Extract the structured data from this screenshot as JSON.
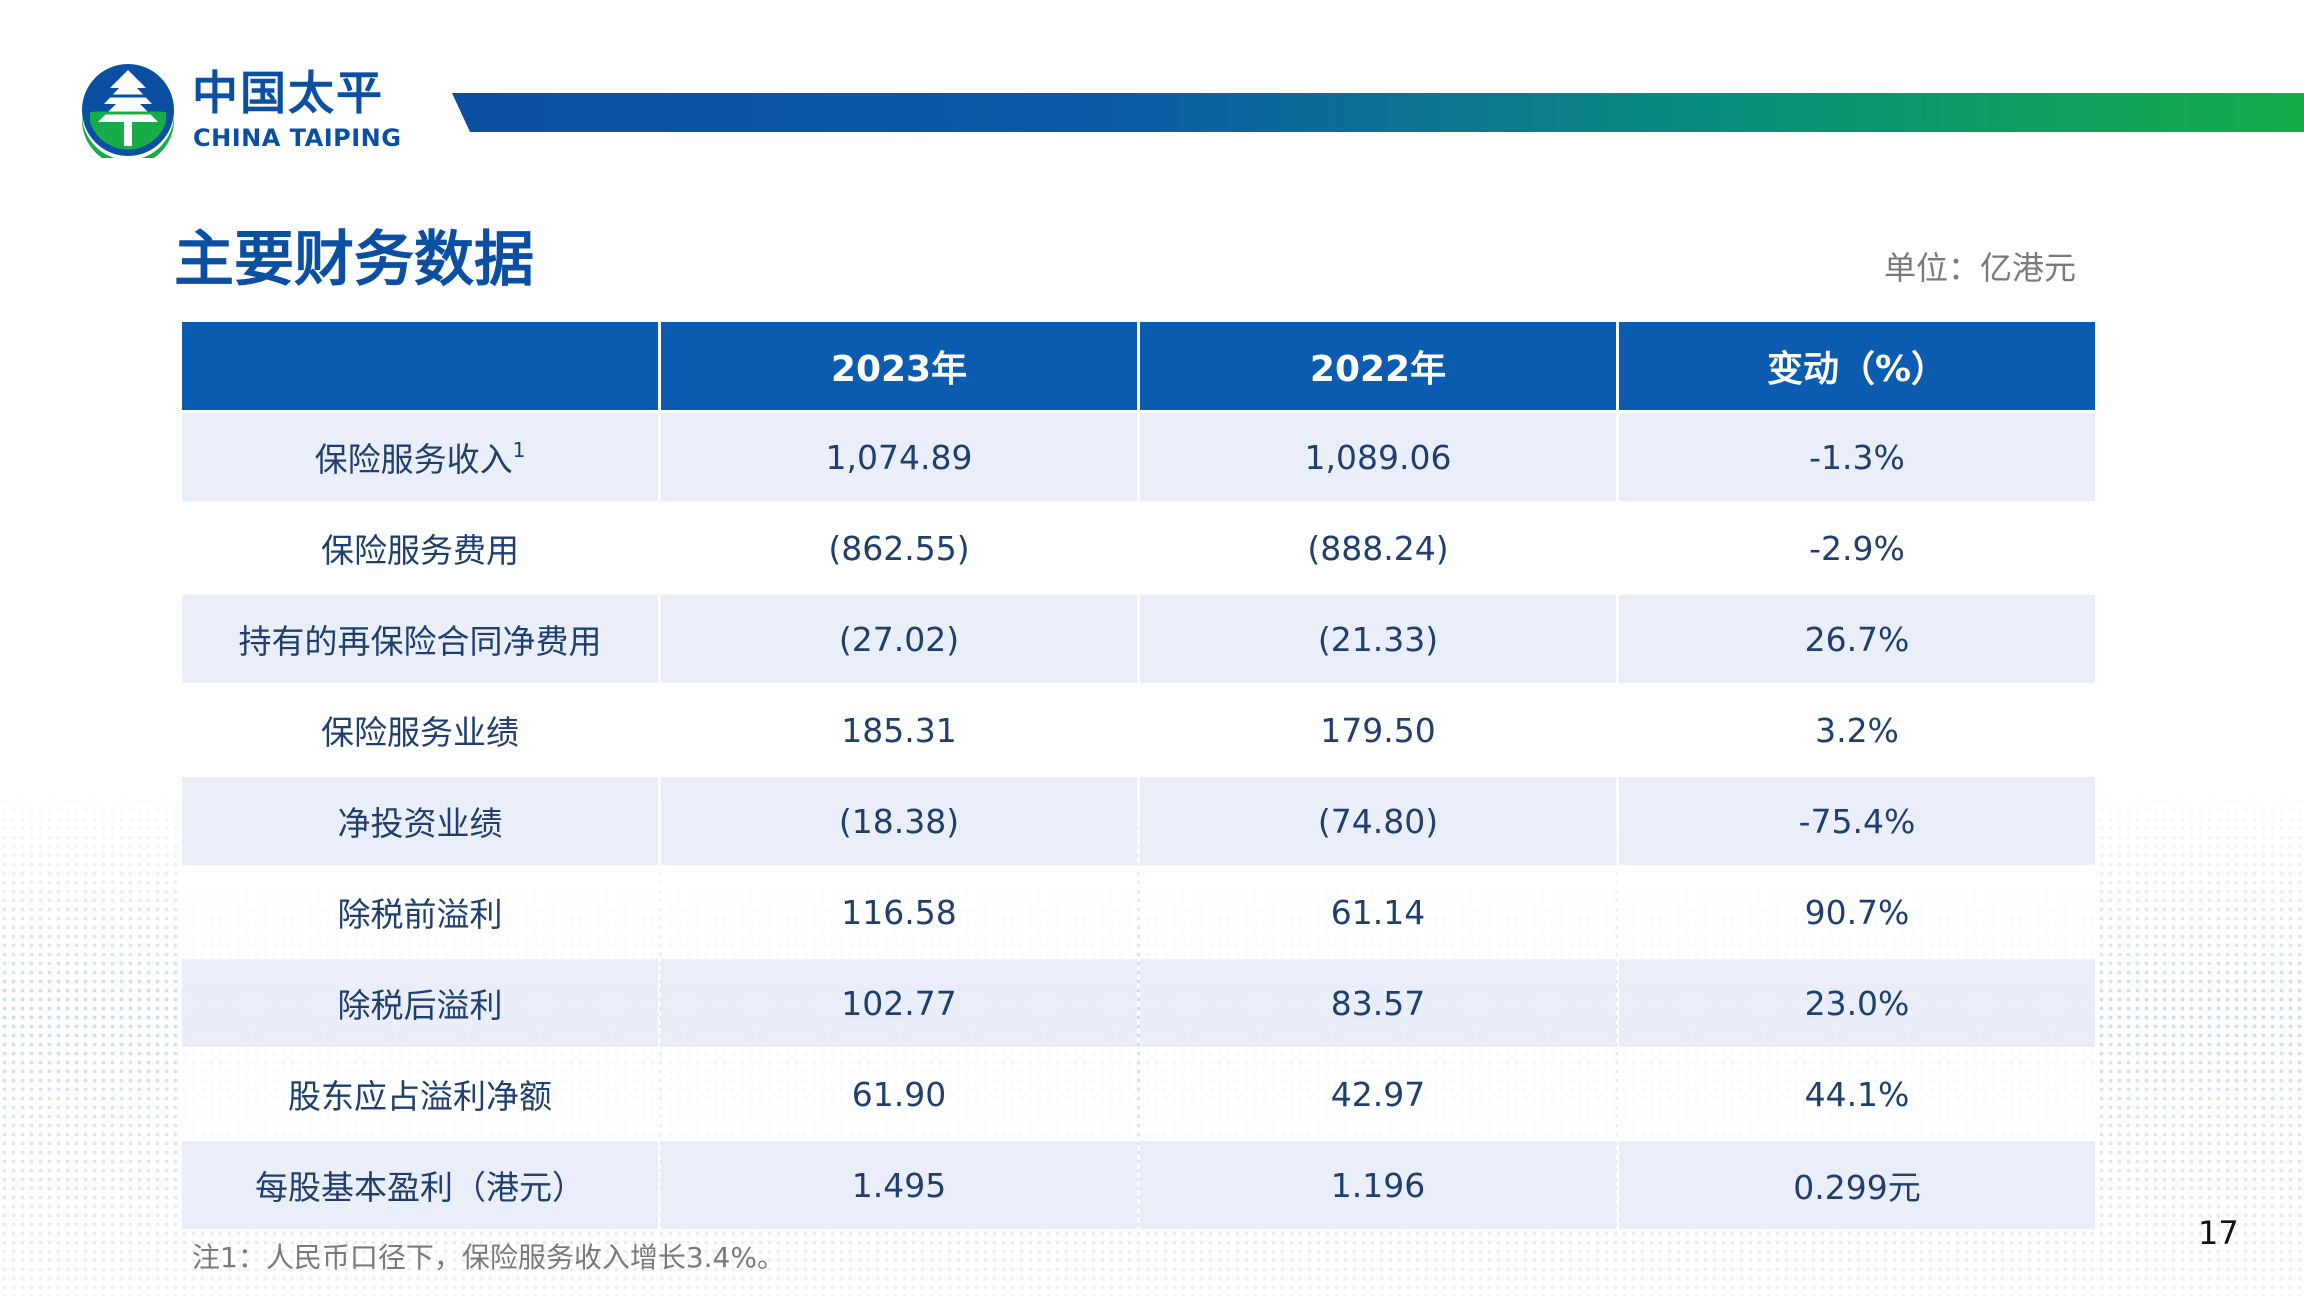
{
  "brand": {
    "name_cn": "中国太平",
    "name_en": "CHINA TAIPING",
    "colors": {
      "blue": "#0b4fa3",
      "green": "#16ad49"
    }
  },
  "page": {
    "title": "主要财务数据",
    "unit": "单位：亿港元",
    "page_number": "17"
  },
  "table": {
    "headers": [
      "",
      "2023年",
      "2022年",
      "变动（%）"
    ],
    "rows": [
      {
        "label": "保险服务收入",
        "footnote": "1",
        "y2023": "1,074.89",
        "y2022": "1,089.06",
        "change": "-1.3%"
      },
      {
        "label": "保险服务费用",
        "y2023": "(862.55)",
        "y2022": "(888.24)",
        "change": "-2.9%"
      },
      {
        "label": "持有的再保险合同净费用",
        "y2023": "(27.02)",
        "y2022": "(21.33)",
        "change": "26.7%"
      },
      {
        "label": "保险服务业绩",
        "y2023": "185.31",
        "y2022": "179.50",
        "change": "3.2%"
      },
      {
        "label": "净投资业绩",
        "y2023": "(18.38)",
        "y2022": "(74.80)",
        "change": "-75.4%"
      },
      {
        "label": "除税前溢利",
        "y2023": "116.58",
        "y2022": "61.14",
        "change": "90.7%"
      },
      {
        "label": "除税后溢利",
        "y2023": "102.77",
        "y2022": "83.57",
        "change": "23.0%"
      },
      {
        "label": "股东应占溢利净额",
        "y2023": "61.90",
        "y2022": "42.97",
        "change": "44.1%"
      },
      {
        "label": "每股基本盈利（港元）",
        "y2023": "1.495",
        "y2022": "1.196",
        "change": "0.299元"
      }
    ]
  },
  "note": "注1：人民币口径下，保险服务收入增长3.4%。"
}
